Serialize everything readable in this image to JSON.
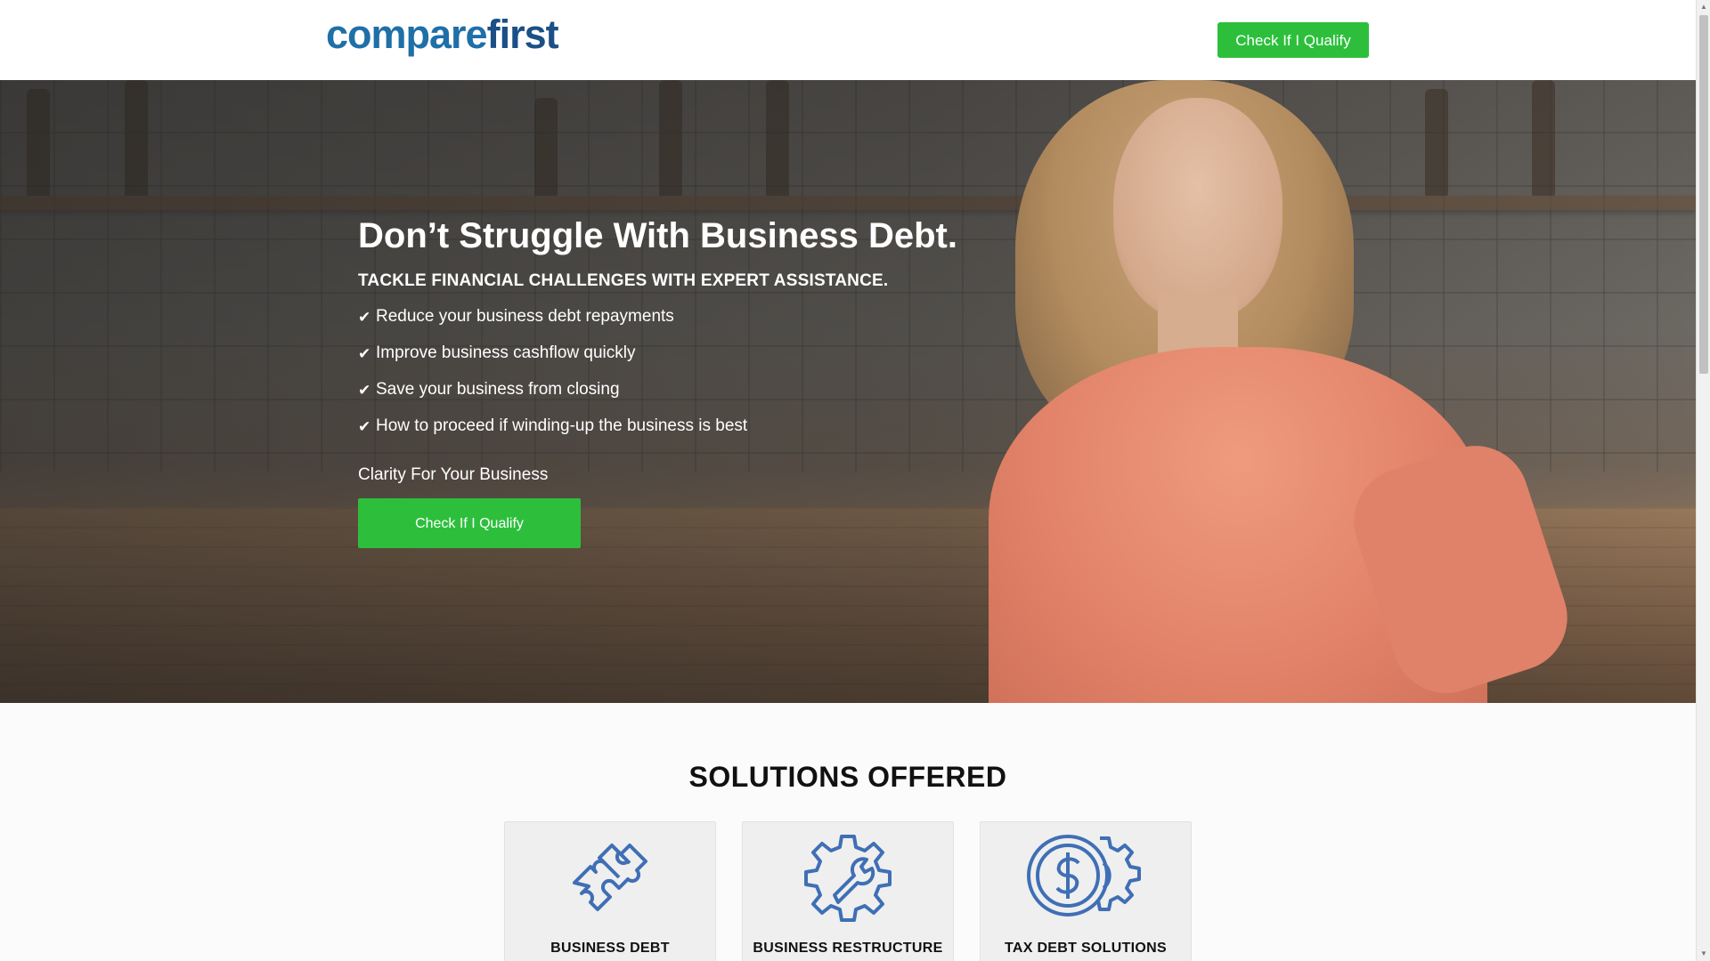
{
  "header": {
    "logo_part1": "compare",
    "logo_part2": "first",
    "cta_label": "Check If I Qualify"
  },
  "hero": {
    "title": "Don’t Struggle With Business Debt.",
    "subtitle": "TACKLE FINANCIAL CHALLENGES WITH EXPERT ASSISTANCE.",
    "benefits": [
      "Reduce your business debt repayments",
      "Improve business cashflow quickly",
      "Save your business from closing",
      "How to proceed if winding-up the business is best"
    ],
    "check_glyph": "✔",
    "tagline": "Clarity For Your Business",
    "cta_label": "Check If I Qualify"
  },
  "solutions": {
    "title": "SOLUTIONS OFFERED",
    "cards": [
      {
        "label": "BUSINESS DEBT SOLUTIONS",
        "icon": "puzzle-icon"
      },
      {
        "label": "BUSINESS RESTRUCTURE",
        "icon": "gear-wrench-icon"
      },
      {
        "label": "TAX DEBT SOLUTIONS",
        "icon": "dollar-gear-icon"
      }
    ]
  },
  "colors": {
    "brand_primary": "#1f6fa8",
    "brand_dark": "#1b4f86",
    "cta_green": "#2dbf3c",
    "icon_blue": "#3f6fb5"
  }
}
